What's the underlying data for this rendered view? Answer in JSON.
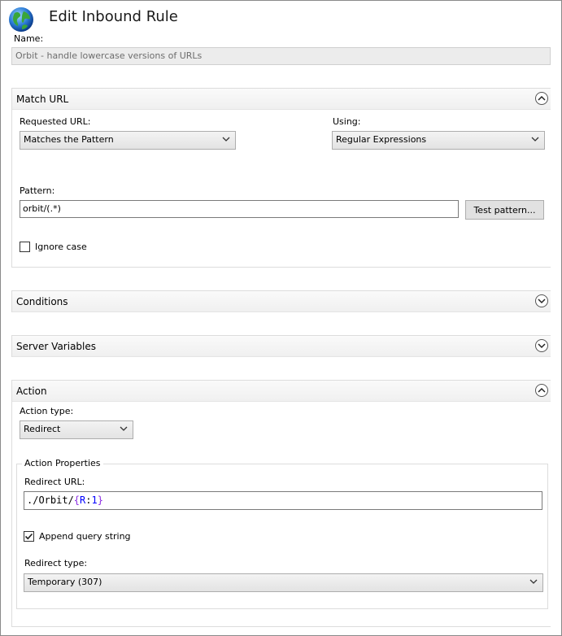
{
  "header": {
    "title": "Edit Inbound Rule",
    "icon": "globe-icon"
  },
  "name": {
    "label": "Name:",
    "value": "Orbit - handle lowercase versions of URLs"
  },
  "match_url": {
    "title": "Match URL",
    "requested_url_label": "Requested URL:",
    "requested_url_value": "Matches the Pattern",
    "using_label": "Using:",
    "using_value": "Regular Expressions",
    "pattern_label": "Pattern:",
    "pattern_value": "orbit/(.*)",
    "test_pattern_button": "Test pattern...",
    "ignore_case_label": "Ignore case",
    "ignore_case_checked": false
  },
  "conditions": {
    "title": "Conditions"
  },
  "server_variables": {
    "title": "Server Variables"
  },
  "action": {
    "title": "Action",
    "action_type_label": "Action type:",
    "action_type_value": "Redirect",
    "properties_title": "Action Properties",
    "redirect_url_label": "Redirect URL:",
    "redirect_url_parts": {
      "prefix": "./Orbit/",
      "open_brace": "{",
      "r_token": "R",
      "colon": ":",
      "index": "1",
      "close_brace": "}"
    },
    "append_query_label": "Append query string",
    "append_query_checked": true,
    "redirect_type_label": "Redirect type:",
    "redirect_type_value": "Temporary (307)"
  },
  "colors": {
    "brace": "#8a2be2",
    "r_token": "#0000ff",
    "index": "#0000ff"
  }
}
